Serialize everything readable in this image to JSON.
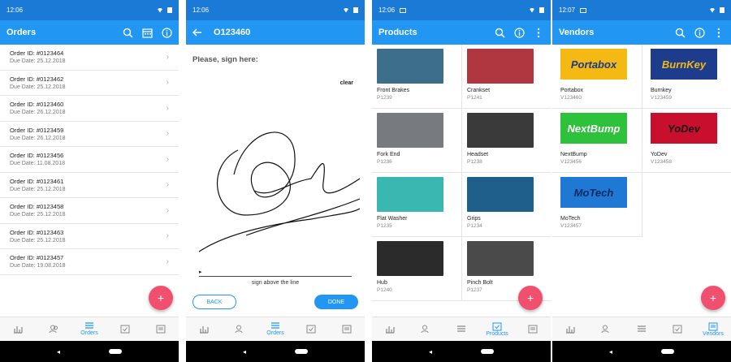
{
  "colors": {
    "status_bar": "#1a7ad6",
    "app_bar": "#2196f3",
    "fab": "#f0506e",
    "accent": "#2196f3"
  },
  "nav_icons": [
    "bar-chart-icon",
    "people-icon",
    "list-icon",
    "checkbox-icon",
    "vendor-icon"
  ],
  "screen1": {
    "time": "12:06",
    "title": "Orders",
    "orders": [
      {
        "id": "Order ID: #0123464",
        "due": "Due Date: 25.12.2018"
      },
      {
        "id": "Order ID: #0123462",
        "due": "Due Date: 25.12.2018"
      },
      {
        "id": "Order ID: #0123460",
        "due": "Due Date: 26.12.2018"
      },
      {
        "id": "Order ID: #0123459",
        "due": "Due Date: 26.12.2018"
      },
      {
        "id": "Order ID: #0123456",
        "due": "Due Date: 11.08.2018"
      },
      {
        "id": "Order ID: #0123461",
        "due": "Due Date: 25.12.2018"
      },
      {
        "id": "Order ID: #0123458",
        "due": "Due Date: 25.12.2018"
      },
      {
        "id": "Order ID: #0123463",
        "due": "Due Date: 25.12.2018"
      },
      {
        "id": "Order ID: #0123457",
        "due": "Due Date: 19.08.2018"
      }
    ],
    "fab": "+",
    "active_label": "Orders"
  },
  "screen2": {
    "time": "12:06",
    "title": "O123460",
    "prompt": "Please, sign here:",
    "clear": "clear",
    "marker": "▸",
    "caption": "sign above the line",
    "back": "BACK",
    "done": "DONE",
    "active_label": "Orders"
  },
  "screen3": {
    "time": "12:06",
    "title": "Products",
    "products": [
      {
        "name": "Front Brakes",
        "code": "P1239",
        "color": "#3d6e8a"
      },
      {
        "name": "Crankset",
        "code": "P1241",
        "color": "#b0363f"
      },
      {
        "name": "Fork End",
        "code": "P1236",
        "color": "#777a7e"
      },
      {
        "name": "Headset",
        "code": "P1238",
        "color": "#3a3a3a"
      },
      {
        "name": "Flat Washer",
        "code": "P1235",
        "color": "#3ab7b0"
      },
      {
        "name": "Grips",
        "code": "P1234",
        "color": "#1f5f8b"
      },
      {
        "name": "Hub",
        "code": "P1240",
        "color": "#2b2b2b"
      },
      {
        "name": "Pinch Bolt",
        "code": "P1237",
        "color": "#4a4a4a"
      }
    ],
    "fab": "+",
    "active_label": "Products"
  },
  "screen4": {
    "time": "12:07",
    "title": "Vendors",
    "vendors": [
      {
        "logo": "Portabox",
        "name": "Portabox",
        "code": "V123460",
        "bg": "#f5b914",
        "fg": "#1a3a8a"
      },
      {
        "logo": "BurnKey",
        "name": "Burnkey",
        "code": "V123459",
        "bg": "#1d3c8c",
        "fg": "#f5b914"
      },
      {
        "logo": "NextBump",
        "name": "NextBump",
        "code": "V123456",
        "bg": "#2ec13b",
        "fg": "#ffffff"
      },
      {
        "logo": "YoDev",
        "name": "YoDev",
        "code": "V123458",
        "bg": "#c8102e",
        "fg": "#1a1a1a"
      },
      {
        "logo": "MoTech",
        "name": "MoTech",
        "code": "V123457",
        "bg": "#1e78d4",
        "fg": "#0d2a60"
      }
    ],
    "fab": "+",
    "active_label": "Vendors"
  }
}
